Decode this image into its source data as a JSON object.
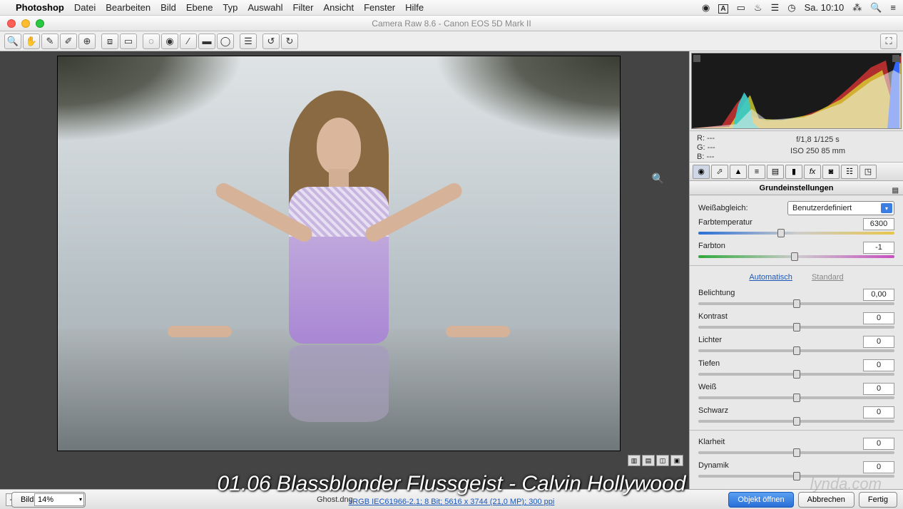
{
  "menubar": {
    "app": "Photoshop",
    "items": [
      "Datei",
      "Bearbeiten",
      "Bild",
      "Ebene",
      "Typ",
      "Auswahl",
      "Filter",
      "Ansicht",
      "Fenster",
      "Hilfe"
    ],
    "clock": "Sa. 10:10"
  },
  "window": {
    "title": "Camera Raw 8.6 - Canon EOS 5D Mark II"
  },
  "meta": {
    "r": "---",
    "g": "---",
    "b": "---",
    "exif_line1": "f/1,8   1/125 s",
    "exif_line2": "ISO 250   85 mm"
  },
  "section_title": "Grundeinstellungen",
  "wb": {
    "label": "Weißabgleich:",
    "value": "Benutzerdefiniert"
  },
  "sliders": {
    "temp": {
      "label": "Farbtemperatur",
      "value": "6300",
      "pos": 42
    },
    "tint": {
      "label": "Farbton",
      "value": "-1",
      "pos": 49
    },
    "exposure": {
      "label": "Belichtung",
      "value": "0,00",
      "pos": 50
    },
    "contrast": {
      "label": "Kontrast",
      "value": "0",
      "pos": 50
    },
    "highlights": {
      "label": "Lichter",
      "value": "0",
      "pos": 50
    },
    "shadows": {
      "label": "Tiefen",
      "value": "0",
      "pos": 50
    },
    "whites": {
      "label": "Weiß",
      "value": "0",
      "pos": 50
    },
    "blacks": {
      "label": "Schwarz",
      "value": "0",
      "pos": 50
    },
    "clarity": {
      "label": "Klarheit",
      "value": "0",
      "pos": 50
    },
    "dynamic": {
      "label": "Dynamik",
      "value": "0",
      "pos": 50
    }
  },
  "links": {
    "auto": "Automatisch",
    "std": "Standard"
  },
  "bottom": {
    "zoom": "14%",
    "filename": "Ghost.dng",
    "colorspace": "sRGB IEC61966-2.1; 8 Bit; 5616 x 3744 (21,0 MP); 300 ppi",
    "save": "Bild speichern...",
    "open": "Objekt öffnen",
    "cancel": "Abbrechen",
    "done": "Fertig"
  },
  "subtitle": "01.06 Blassblonder Flussgeist - Calvin Hollywood",
  "watermark": "lynda.com"
}
